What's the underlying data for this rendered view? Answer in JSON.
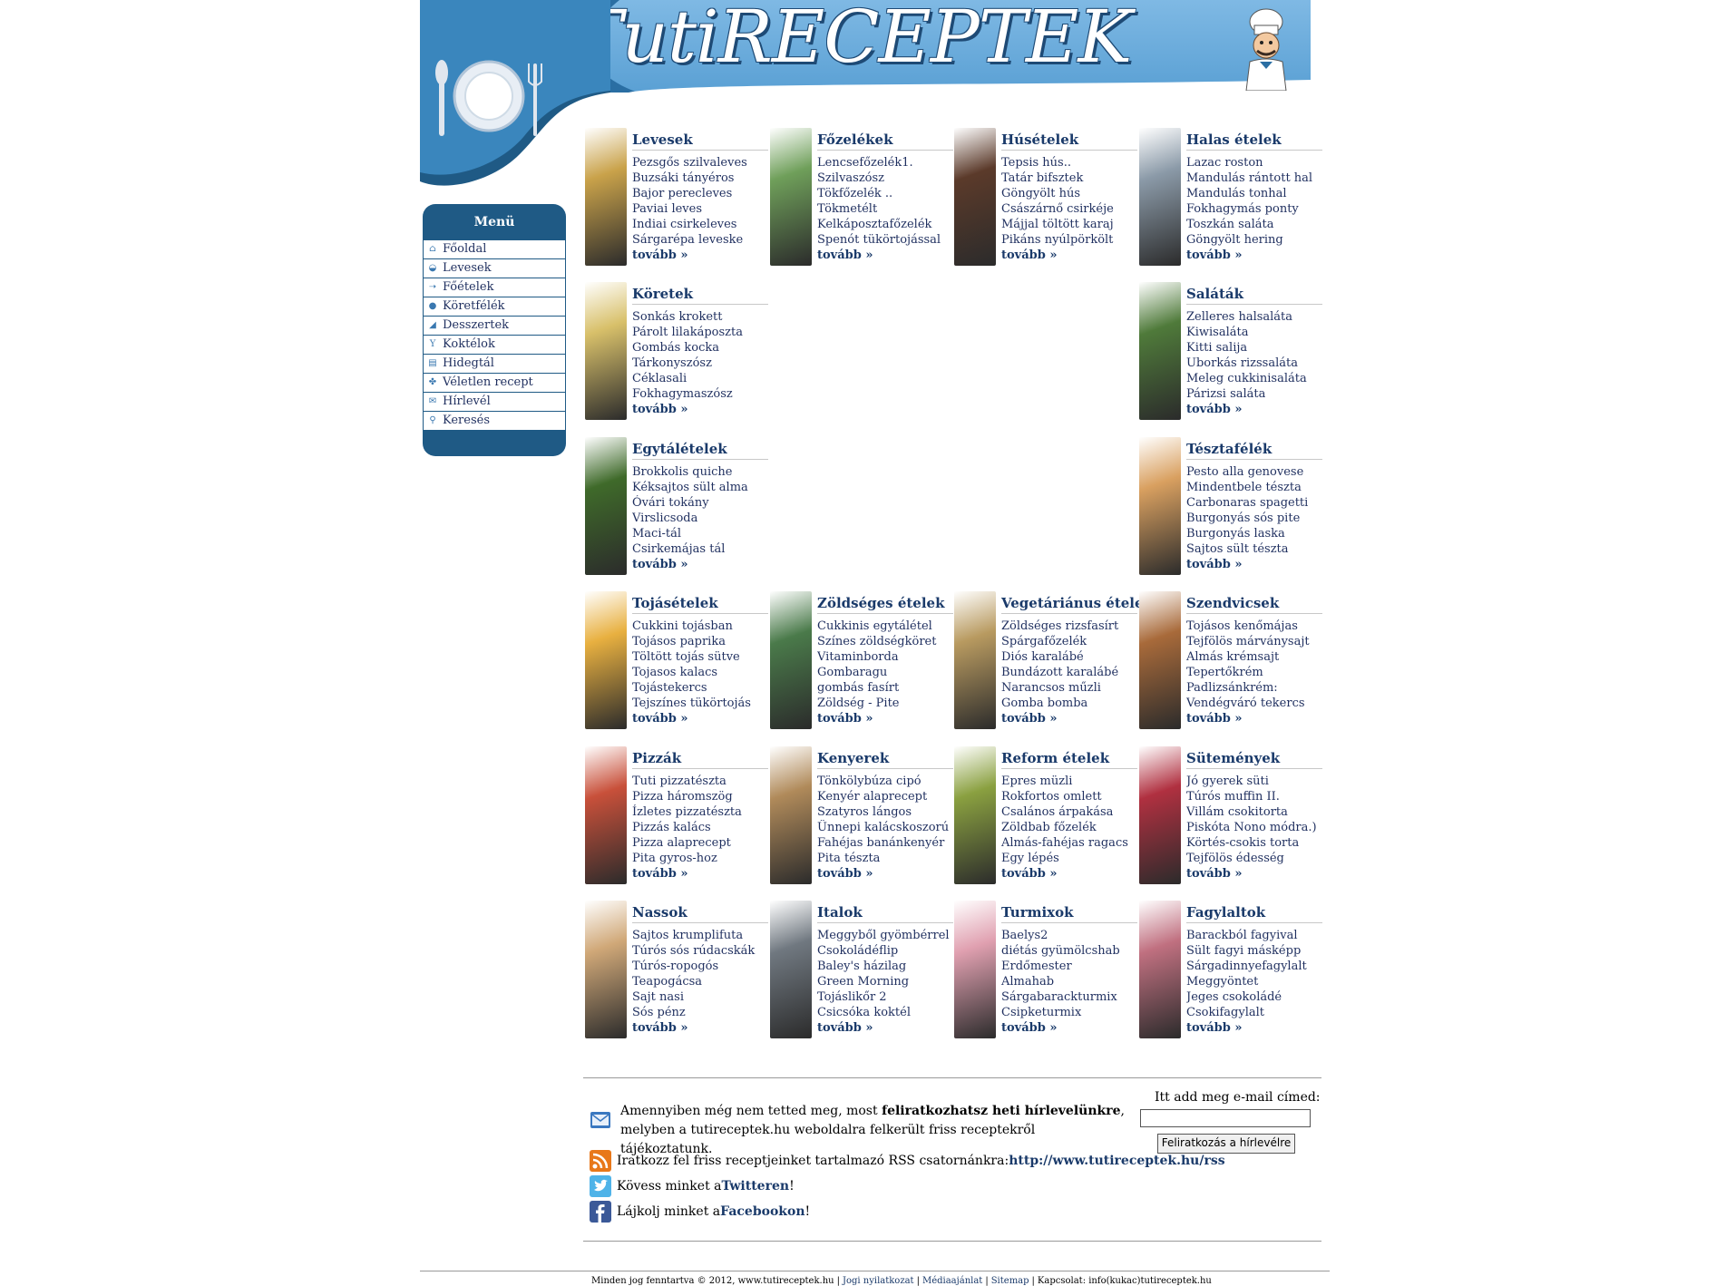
{
  "header": {
    "logo_text": "TutiRECEPTEK"
  },
  "menu": {
    "title": "Menü",
    "items": [
      {
        "label": "Főoldal",
        "icon": "home-icon"
      },
      {
        "label": "Levesek",
        "icon": "soup-icon"
      },
      {
        "label": "Főételek",
        "icon": "main-dish-icon"
      },
      {
        "label": "Köretfélék",
        "icon": "side-dish-icon"
      },
      {
        "label": "Desszertek",
        "icon": "dessert-icon"
      },
      {
        "label": "Koktélok",
        "icon": "cocktail-icon"
      },
      {
        "label": "Hidegtál",
        "icon": "cold-plate-icon"
      },
      {
        "label": "Véletlen recept",
        "icon": "random-icon"
      },
      {
        "label": "Hírlevél",
        "icon": "envelope-icon"
      },
      {
        "label": "Keresés",
        "icon": "search-icon"
      }
    ]
  },
  "more_label": "tovább »",
  "categories": [
    {
      "title": "Levesek",
      "items": [
        "Pezsgős szilvaleves",
        "Buzsáki tányéros",
        "Bajor perecleves",
        "Paviai leves",
        "Indiai csirkeleves",
        "Sárgarépa leveske"
      ],
      "color": "#c9a24a"
    },
    {
      "title": "Főzelékek",
      "items": [
        "Lencsefőzelék1.",
        "Szilvaszósz",
        "Tökfőzelék ..",
        "Tökmetélt",
        "Kelkáposztafőzelék",
        "Spenót tükörtojással"
      ],
      "color": "#6f9f5a"
    },
    {
      "title": "Húsételek",
      "items": [
        "Tepsis hús..",
        "Tatár bifsztek",
        "Göngyölt hús",
        "Császárnő csirkéje",
        "Májjal töltött karaj",
        "Pikáns nyúlpörkölt"
      ],
      "color": "#5b3a2a"
    },
    {
      "title": "Halas ételek",
      "items": [
        "Lazac roston",
        "Mandulás rántott hal",
        "Mandulás tonhal",
        "Fokhagymás ponty",
        "Toszkán saláta",
        "Göngyölt hering"
      ],
      "color": "#8b9aa8"
    },
    {
      "title": "Köretek",
      "items": [
        "Sonkás krokett",
        "Párolt lilakáposzta",
        "Gombás kocka",
        "Tárkonyszósz",
        "Céklasali",
        "Fokhagymaszósz"
      ],
      "color": "#d8c06a"
    },
    {
      "title": "Saláták",
      "items": [
        "Zelleres halsaláta",
        "Kiwisaláta",
        "Kitti salija",
        "Uborkás rizssaláta",
        "Meleg cukkinisaláta",
        "Párizsi saláta"
      ],
      "color": "#4f7a3a"
    },
    {
      "title": "Egytálételek",
      "items": [
        "Brokkolis quiche",
        "Kéksajtos sült alma",
        "Óvári tokány",
        "Virslicsoda",
        "Maci-tál",
        "Csirkemájas tál"
      ],
      "color": "#3f6a2a"
    },
    {
      "title": "Tésztafélék",
      "items": [
        "Pesto alla genovese",
        "Mindentbele tészta",
        "Carbonaras spagetti",
        "Burgonyás sós pite",
        "Burgonyás laska",
        "Sajtos sült tészta"
      ],
      "color": "#d9a060"
    },
    {
      "title": "Tojásételek",
      "items": [
        "Cukkini tojásban",
        "Tojásos paprika",
        "Töltött tojás sütve",
        "Tojasos kalacs",
        "Tojástekercs",
        "Tejszínes tükörtojás"
      ],
      "color": "#e8b040"
    },
    {
      "title": "Zöldséges ételek",
      "items": [
        "Cukkinis egytálétel",
        "Színes zöldségköret",
        "Vitaminborda",
        "Gombaragu",
        "gombás fasírt",
        "Zöldség - Pite"
      ],
      "color": "#4a7a4a"
    },
    {
      "title": "Vegetáriánus ételek",
      "items": [
        "Zöldséges rizsfasírt",
        "Spárgafőzelék",
        "Diós karalábé",
        "Bundázott karalábé",
        "Narancsos műzli",
        "Gomba bomba"
      ],
      "color": "#b89a60"
    },
    {
      "title": "Szendvicsek",
      "items": [
        "Tojásos kenőmájas",
        "Tejfölös márványsajt",
        "Almás krémsajt",
        "Tepertőkrém",
        "Padlizsánkrém:",
        "Vendégváró tekercs"
      ],
      "color": "#a86a3a"
    },
    {
      "title": "Pizzák",
      "items": [
        "Tuti pizzatészta",
        "Pizza háromszög",
        "Ízletes pizzatészta",
        "Pizzás kalács",
        "Pizza alaprecept",
        "Pita gyros-hoz"
      ],
      "color": "#c8503a"
    },
    {
      "title": "Kenyerek",
      "items": [
        "Tönkölybúza cipó",
        "Kenyér alaprecept",
        "Szatyros lángos",
        "Ünnepi kalácskoszorú",
        "Fahéjas banánkenyér",
        "Pita tészta"
      ],
      "color": "#b08a5a"
    },
    {
      "title": "Reform ételek",
      "items": [
        "Epres müzli",
        "Rokfortos omlett",
        "Csalános árpakása",
        "Zöldbab főzelék",
        "Almás-fahéjas ragacs",
        "Egy lépés"
      ],
      "color": "#8aa040"
    },
    {
      "title": "Sütemények",
      "items": [
        "Jó gyerek süti",
        "Túrós muffin II.",
        "Villám csokitorta",
        "Piskóta Nono módra.)",
        "Körtés-csokis torta",
        "Tejfölös édesség"
      ],
      "color": "#b03040"
    },
    {
      "title": "Nassok",
      "items": [
        "Sajtos krumplifuta",
        "Túrós sós rúdacskák",
        "Túrós-ropogós",
        "Teapogácsa",
        "Sajt nasi",
        "Sós pénz"
      ],
      "color": "#d0a878"
    },
    {
      "title": "Italok",
      "items": [
        "Meggyből gyömbérrel",
        "Csokoládéflip",
        "Baley's házilag",
        "Green Morning",
        "Tojáslikőr 2",
        "Csicsóka koktél"
      ],
      "color": "#707880"
    },
    {
      "title": "Turmixok",
      "items": [
        "Baelys2",
        "diétás gyümölcshab",
        "Erdőmester",
        "Almahab",
        "Sárgabarackturmix",
        "Csipketurmix"
      ],
      "color": "#e0a0b0"
    },
    {
      "title": "Fagylaltok",
      "items": [
        "Barackból fagyival",
        "Sült fagyi másképp",
        "Sárgadinnyefagylalt",
        "Meggyöntet",
        "Jeges csokoládé",
        "Csokifagylalt"
      ],
      "color": "#c07080"
    }
  ],
  "newsletter": {
    "text_before": "Amennyiben még nem tetted meg, most ",
    "text_bold": "feliratkozhatsz heti hírlevelünkre",
    "text_after": ", melyben a tutireceptek.hu weboldalra felkerült friss receptekről tájékoztatunk.",
    "email_label": "Itt add meg e-mail címed:",
    "email_value": "",
    "button_label": "Feliratkozás a hírlevélre"
  },
  "social": {
    "rss_text": "Iratkozz fel friss receptjeinket tartalmazó RSS csatornánkra: ",
    "rss_link": "http://www.tutireceptek.hu/rss",
    "twitter_before": "Kövess minket a ",
    "twitter_link": "Twitteren",
    "twitter_after": "!",
    "facebook_before": "Lájkolj minket a ",
    "facebook_link": "Facebookon",
    "facebook_after": "!"
  },
  "footer": {
    "copyright": "Minden jog fenntartva © 2012, www.tutireceptek.hu",
    "links": [
      "Jogi nyilatkozat",
      "Médiaajánlat",
      "Sitemap"
    ],
    "contact": "Kapcsolat: info(kukac)tutireceptek.hu"
  },
  "colors": {
    "header_blue": "#5aa0d4",
    "menu_dark": "#1f5a85",
    "link_navy": "#1a3a6a"
  }
}
